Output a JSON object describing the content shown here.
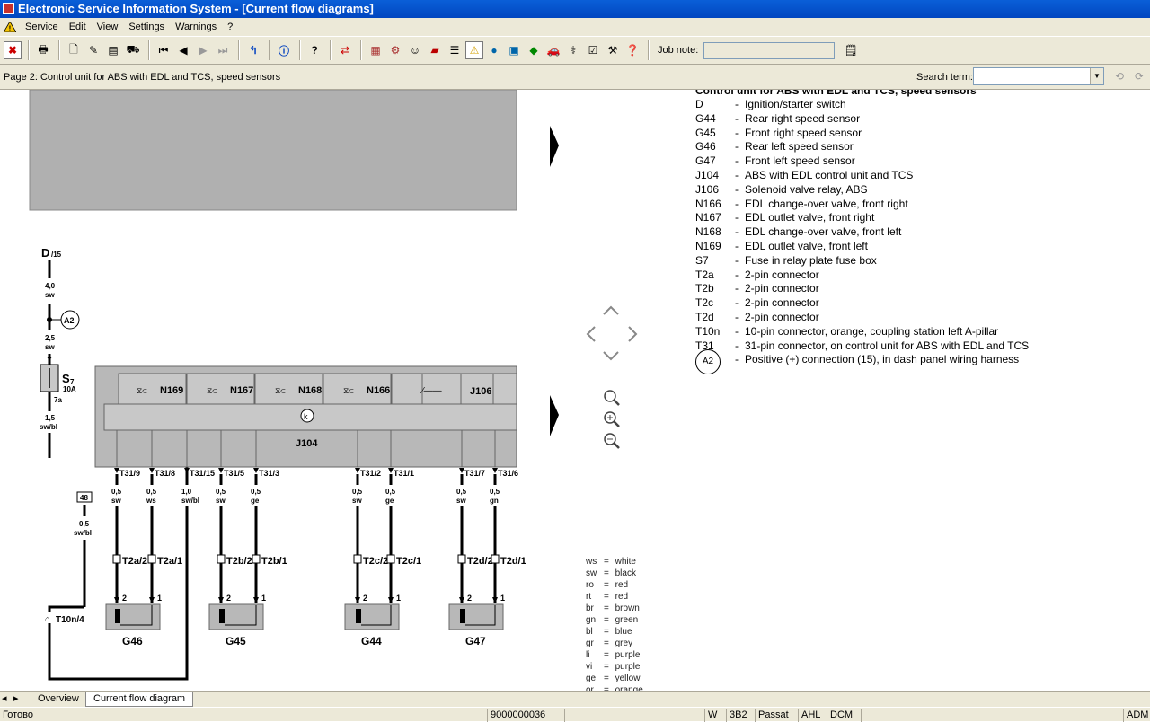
{
  "window": {
    "title": "Electronic Service Information System - [Current flow diagrams]"
  },
  "menu": {
    "items": [
      "Service",
      "Edit",
      "View",
      "Settings",
      "Warnings",
      "?"
    ]
  },
  "toolbar": {
    "job_note_label": "Job note:",
    "job_note_value": ""
  },
  "subbar": {
    "page_title": "Page 2: Control unit for ABS with EDL and TCS, speed sensors",
    "search_label": "Search term:",
    "search_value": ""
  },
  "legend": {
    "title": "Control unit for ABS with EDL and TCS, speed sensors",
    "rows": [
      {
        "code": "D",
        "desc": "Ignition/starter switch"
      },
      {
        "code": "G44",
        "desc": "Rear right speed sensor"
      },
      {
        "code": "G45",
        "desc": "Front right speed sensor"
      },
      {
        "code": "G46",
        "desc": "Rear left speed sensor"
      },
      {
        "code": "G47",
        "desc": "Front left speed sensor"
      },
      {
        "code": "J104",
        "desc": "ABS with EDL control unit and TCS"
      },
      {
        "code": "J106",
        "desc": "Solenoid valve relay, ABS"
      },
      {
        "code": "N166",
        "desc": "EDL change-over valve, front right"
      },
      {
        "code": "N167",
        "desc": "EDL outlet valve, front right"
      },
      {
        "code": "N168",
        "desc": "EDL change-over valve, front left"
      },
      {
        "code": "N169",
        "desc": "EDL outlet valve, front left"
      },
      {
        "code": "S7",
        "desc": "Fuse in relay plate fuse box"
      },
      {
        "code": "T2a",
        "desc": "2-pin connector"
      },
      {
        "code": "T2b",
        "desc": "2-pin connector"
      },
      {
        "code": "T2c",
        "desc": "2-pin connector"
      },
      {
        "code": "T2d",
        "desc": "2-pin connector"
      },
      {
        "code": "T10n",
        "desc": "10-pin connector, orange, coupling station left A-pillar"
      },
      {
        "code": "T31",
        "desc": "31-pin connector, on control unit for ABS with EDL and TCS"
      },
      {
        "code": "A2",
        "desc": "Positive (+) connection (15), in dash panel wiring harness"
      }
    ]
  },
  "color_key": [
    {
      "ab": "ws",
      "name": "white"
    },
    {
      "ab": "sw",
      "name": "black"
    },
    {
      "ab": "ro",
      "name": "red"
    },
    {
      "ab": "rt",
      "name": "red"
    },
    {
      "ab": "br",
      "name": "brown"
    },
    {
      "ab": "gn",
      "name": "green"
    },
    {
      "ab": "bl",
      "name": "blue"
    },
    {
      "ab": "gr",
      "name": "grey"
    },
    {
      "ab": "li",
      "name": "purple"
    },
    {
      "ab": "vi",
      "name": "purple"
    },
    {
      "ab": "ge",
      "name": "yellow"
    },
    {
      "ab": "or",
      "name": "orange"
    }
  ],
  "diagram": {
    "terminal": "D",
    "terminal_sub": "/15",
    "wire_top": "4,0",
    "wire_top_color": "sw",
    "a2": "A2",
    "wire_mid": "2,5",
    "wire_mid_color": "sw",
    "fuse": "S",
    "fuse_sub": "7",
    "fuse_rating": "10A",
    "fuse_pin": "7a",
    "wire_fuse": "1,5",
    "wire_fuse_color": "sw/bl",
    "box48": "48",
    "wire48": "0,5",
    "wire48_color": "sw/bl",
    "t10n": "T10n/4",
    "j104": "J104",
    "n169": "N169",
    "n167": "N167",
    "n168": "N168",
    "n166": "N166",
    "j106": "J106",
    "pins": [
      {
        "pin": "T31/9",
        "size": "0,5",
        "color": "sw"
      },
      {
        "pin": "T31/8",
        "size": "0,5",
        "color": "ws"
      },
      {
        "pin": "T31/15",
        "size": "1,0",
        "color": "sw/bl"
      },
      {
        "pin": "T31/5",
        "size": "0,5",
        "color": "sw"
      },
      {
        "pin": "T31/3",
        "size": "0,5",
        "color": "ge"
      },
      {
        "pin": "T31/2",
        "size": "0,5",
        "color": "sw"
      },
      {
        "pin": "T31/1",
        "size": "0,5",
        "color": "ge"
      },
      {
        "pin": "T31/7",
        "size": "0,5",
        "color": "sw"
      },
      {
        "pin": "T31/6",
        "size": "0,5",
        "color": "gn"
      }
    ],
    "connectors": [
      "T2a/2",
      "T2a/1",
      "T2b/2",
      "T2b/1",
      "T2c/2",
      "T2c/1",
      "T2d/2",
      "T2d/1"
    ],
    "sensors": [
      "G46",
      "G45",
      "G44",
      "G47"
    ],
    "pin_numbers": [
      "2",
      "1"
    ]
  },
  "tabs": {
    "overview": "Overview",
    "current": "Current flow diagram"
  },
  "status": {
    "left": "Готово",
    "code": "9000000036",
    "c1": "W",
    "c2": "3B2",
    "c3": "Passat",
    "c4": "AHL",
    "c5": "DCM",
    "c6": "ADM"
  },
  "colors": {
    "titlebar": "#0a5fd8",
    "chrome": "#ece9d8",
    "diagram_grey": "#b0b0b0"
  }
}
